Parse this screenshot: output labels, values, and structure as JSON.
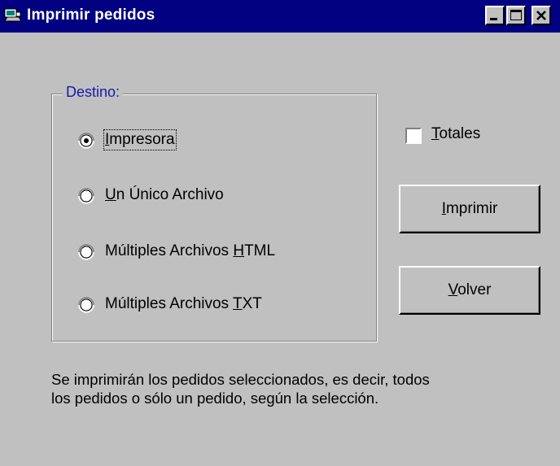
{
  "window": {
    "title": "Imprimir pedidos"
  },
  "destination": {
    "legend": "Destino:",
    "options": [
      {
        "pre": "",
        "mnemonic": "I",
        "post": "mpresora",
        "selected": true
      },
      {
        "pre": "",
        "mnemonic": "U",
        "post": "n Único Archivo",
        "selected": false
      },
      {
        "pre": "Múltiples Archivos ",
        "mnemonic": "H",
        "post": "TML",
        "selected": false
      },
      {
        "pre": "Múltiples Archivos ",
        "mnemonic": "T",
        "post": "XT",
        "selected": false
      }
    ]
  },
  "totals": {
    "mnemonic": "T",
    "rest": "otales",
    "checked": false
  },
  "buttons": {
    "print": {
      "mnemonic": "I",
      "rest": "mprimir"
    },
    "back": {
      "mnemonic": "V",
      "rest": "olver"
    }
  },
  "description": {
    "line1": "Se imprimirán los pedidos seleccionados, es decir, todos",
    "line2": "los pedidos o sólo un pedido, según la selección."
  },
  "colors": {
    "titlebar": "#000080",
    "face": "#c0c0c0",
    "legend_text": "#1a1aa8"
  }
}
